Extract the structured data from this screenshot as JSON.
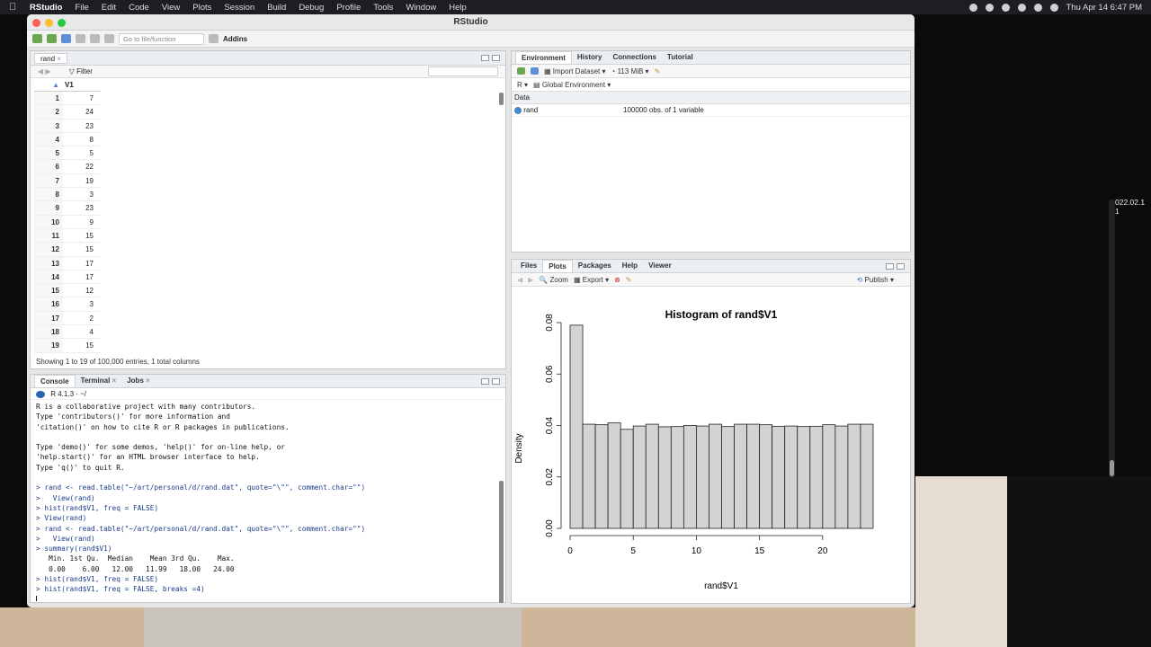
{
  "menubar": {
    "app": "RStudio",
    "items": [
      "File",
      "Edit",
      "Code",
      "View",
      "Plots",
      "Session",
      "Build",
      "Debug",
      "Profile",
      "Tools",
      "Window",
      "Help"
    ],
    "clock": "Thu Apr 14  6:47 PM"
  },
  "window": {
    "title": "RStudio"
  },
  "toolbar": {
    "goto_placeholder": "Go to file/function",
    "addins": "Addins"
  },
  "dataviewer": {
    "tab": "rand",
    "filter": "Filter",
    "column": "V1",
    "rows": [
      {
        "n": "1",
        "v": "7"
      },
      {
        "n": "2",
        "v": "24"
      },
      {
        "n": "3",
        "v": "23"
      },
      {
        "n": "4",
        "v": "8"
      },
      {
        "n": "5",
        "v": "5"
      },
      {
        "n": "6",
        "v": "22"
      },
      {
        "n": "7",
        "v": "19"
      },
      {
        "n": "8",
        "v": "3"
      },
      {
        "n": "9",
        "v": "23"
      },
      {
        "n": "10",
        "v": "9"
      },
      {
        "n": "11",
        "v": "15"
      },
      {
        "n": "12",
        "v": "15"
      },
      {
        "n": "13",
        "v": "17"
      },
      {
        "n": "14",
        "v": "17"
      },
      {
        "n": "15",
        "v": "12"
      },
      {
        "n": "16",
        "v": "3"
      },
      {
        "n": "17",
        "v": "2"
      },
      {
        "n": "18",
        "v": "4"
      },
      {
        "n": "19",
        "v": "15"
      }
    ],
    "status": "Showing 1 to 19 of 100,000 entries, 1 total columns"
  },
  "console": {
    "tabs": [
      "Console",
      "Terminal",
      "Jobs"
    ],
    "version": "R 4.1.3 · ~/",
    "lines": [
      {
        "t": "R is a collaborative project with many contributors.",
        "c": false
      },
      {
        "t": "Type 'contributors()' for more information and",
        "c": false
      },
      {
        "t": "'citation()' on how to cite R or R packages in publications.",
        "c": false
      },
      {
        "t": "",
        "c": false
      },
      {
        "t": "Type 'demo()' for some demos, 'help()' for on-line help, or",
        "c": false
      },
      {
        "t": "'help.start()' for an HTML browser interface to help.",
        "c": false
      },
      {
        "t": "Type 'q()' to quit R.",
        "c": false
      },
      {
        "t": "",
        "c": false
      },
      {
        "t": "> rand <- read.table(\"~/art/personal/d/rand.dat\", quote=\"\\\"\", comment.char=\"\")",
        "c": true
      },
      {
        "t": ">   View(rand)",
        "c": true
      },
      {
        "t": "> hist(rand$V1, freq = FALSE)",
        "c": true
      },
      {
        "t": "> View(rand)",
        "c": true
      },
      {
        "t": "> rand <- read.table(\"~/art/personal/d/rand.dat\", quote=\"\\\"\", comment.char=\"\")",
        "c": true
      },
      {
        "t": ">   View(rand)",
        "c": true
      },
      {
        "t": "> summary(rand$V1)",
        "c": true
      },
      {
        "t": "   Min. 1st Qu.  Median    Mean 3rd Qu.    Max.",
        "c": false
      },
      {
        "t": "   0.00    6.00   12.00   11.99   18.00   24.00",
        "c": false
      },
      {
        "t": "> hist(rand$V1, freq = FALSE)",
        "c": true
      },
      {
        "t": "> hist(rand$V1, freq = FALSE, breaks =4)",
        "c": true
      },
      {
        "t": "",
        "c": false
      }
    ]
  },
  "environment": {
    "tabs": [
      "Environment",
      "History",
      "Connections",
      "Tutorial"
    ],
    "import": "Import Dataset",
    "memory": "113 MiB",
    "lang": "R",
    "scope": "Global Environment",
    "section": "Data",
    "object": {
      "name": "rand",
      "desc": "100000 obs. of 1 variable"
    }
  },
  "plots": {
    "tabs": [
      "Files",
      "Plots",
      "Packages",
      "Help",
      "Viewer"
    ],
    "zoom": "Zoom",
    "export": "Export",
    "publish": "Publish"
  },
  "right_overlay": {
    "text1": "022.02.1",
    "text2": "1"
  },
  "chart_data": {
    "type": "bar",
    "title": "Histogram of rand$V1",
    "xlabel": "rand$V1",
    "ylabel": "Density",
    "xlim": [
      0,
      24
    ],
    "ylim": [
      0,
      0.08
    ],
    "yticks": [
      "0.00",
      "0.02",
      "0.04",
      "0.06",
      "0.08"
    ],
    "xticks": [
      "0",
      "5",
      "10",
      "15",
      "20"
    ],
    "bins": [
      [
        0,
        1
      ],
      [
        1,
        2
      ],
      [
        2,
        3
      ],
      [
        3,
        4
      ],
      [
        4,
        5
      ],
      [
        5,
        6
      ],
      [
        6,
        7
      ],
      [
        7,
        8
      ],
      [
        8,
        9
      ],
      [
        9,
        10
      ],
      [
        10,
        11
      ],
      [
        11,
        12
      ],
      [
        12,
        13
      ],
      [
        13,
        14
      ],
      [
        14,
        15
      ],
      [
        15,
        16
      ],
      [
        16,
        17
      ],
      [
        17,
        18
      ],
      [
        18,
        19
      ],
      [
        19,
        20
      ],
      [
        20,
        21
      ],
      [
        21,
        22
      ],
      [
        22,
        23
      ],
      [
        23,
        24
      ]
    ],
    "values": [
      0.079,
      0.0405,
      0.0403,
      0.041,
      0.0385,
      0.0398,
      0.0405,
      0.0395,
      0.0396,
      0.04,
      0.0398,
      0.0405,
      0.0396,
      0.0405,
      0.0405,
      0.0403,
      0.0397,
      0.0398,
      0.0396,
      0.0397,
      0.0403,
      0.0398,
      0.0405,
      0.0405
    ],
    "colors": {
      "bar": "#d3d3d3",
      "stroke": "#222222"
    }
  }
}
